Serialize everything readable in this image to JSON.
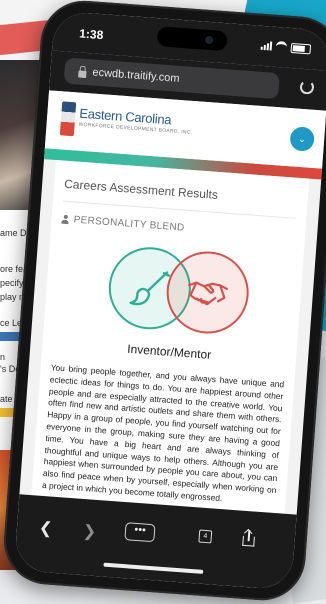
{
  "background": {
    "snippets": [
      "ame De",
      "ore feat",
      "pecify i",
      "play m",
      "ce Lev",
      "n",
      "'s De",
      "ate"
    ]
  },
  "status_bar": {
    "time": "1:38"
  },
  "browser": {
    "url": "ecwdb.traitify.com"
  },
  "site": {
    "logo_title": "Eastern Carolina",
    "logo_subtitle": "WORKFORCE DEVELOPMENT BOARD, INC."
  },
  "assessment": {
    "title": "Careers Assessment Results",
    "section_label": "PERSONALITY BLEND",
    "blend_icons": [
      "paintbrush-icon",
      "handshake-icon"
    ],
    "blend_colors": {
      "left": "#2fae95",
      "right": "#d9504a"
    },
    "result_name": "Inventor/Mentor",
    "result_description": "You bring people together, and you always have unique and eclectic ideas for things to do. You are happiest around other people and are especially attracted to the creative world. You often find new and artistic outlets and share them with others. Happy in a group of people, you find yourself watching out for everyone in the group, making sure they are having a good time. You have a big heart and are always thinking of thoughtful and unique ways to help others. Although you are happiest when surrounded by people you care about, you can also find peace when by yourself, especially when working on a project in which you become totally engrossed."
  },
  "toolbar": {
    "tab_count": "4",
    "more_label": "•••"
  }
}
